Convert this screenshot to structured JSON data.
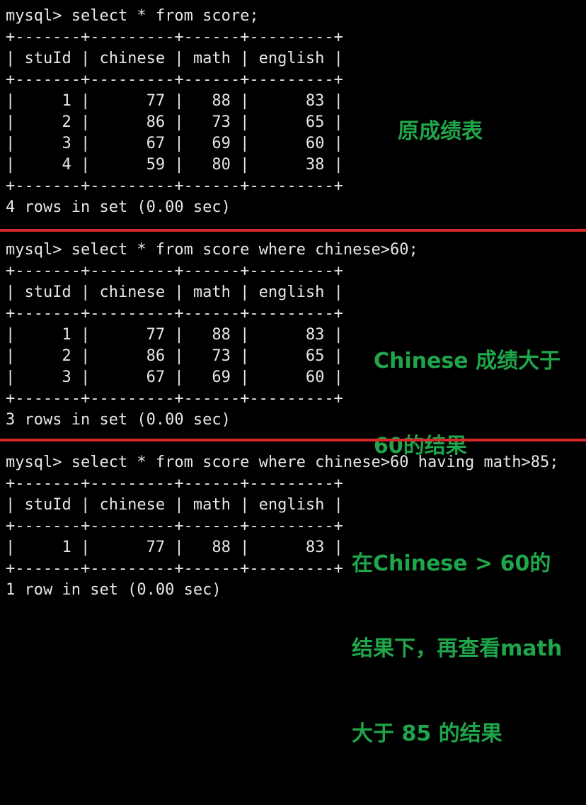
{
  "colors": {
    "background": "#000000",
    "terminal_text": "#e6e6e6",
    "annotation_green": "#1fa64a",
    "divider_red": "#d9262b"
  },
  "sections": [
    {
      "command": "mysql> select * from score;",
      "table": {
        "border": "+-------+---------+------+---------+",
        "header": "| stuId | chinese | math | english |",
        "rows": [
          "|     1 |      77 |   88 |      83 |",
          "|     2 |      86 |   73 |      65 |",
          "|     3 |      67 |   69 |      60 |",
          "|     4 |      59 |   80 |      38 |"
        ]
      },
      "result": "4 rows in set (0.00 sec)",
      "annotation": [
        "原成绩表"
      ]
    },
    {
      "command": "mysql> select * from score where chinese>60;",
      "table": {
        "border": "+-------+---------+------+---------+",
        "header": "| stuId | chinese | math | english |",
        "rows": [
          "|     1 |      77 |   88 |      83 |",
          "|     2 |      86 |   73 |      65 |",
          "|     3 |      67 |   69 |      60 |"
        ]
      },
      "result": "3 rows in set (0.00 sec)",
      "annotation": [
        "Chinese 成绩大于",
        "60的结果"
      ]
    },
    {
      "command": "mysql> select * from score where chinese>60 having math>85;",
      "table": {
        "border": "+-------+---------+------+---------+",
        "header": "| stuId | chinese | math | english |",
        "rows": [
          "|     1 |      77 |   88 |      83 |"
        ]
      },
      "result": "1 row in set (0.00 sec)",
      "annotation": [
        "在Chinese > 60的",
        "结果下，再查看math",
        "大于 85 的结果"
      ]
    }
  ]
}
